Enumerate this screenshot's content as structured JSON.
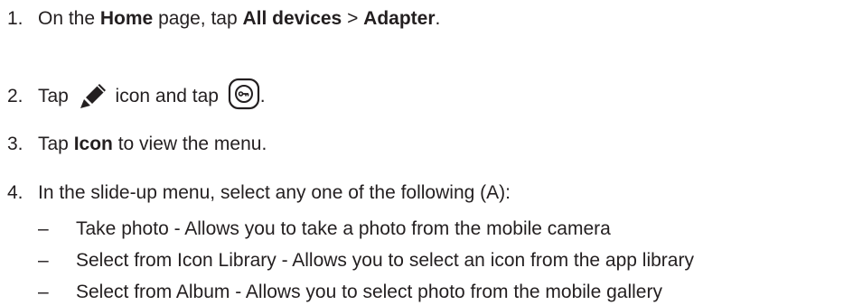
{
  "steps": [
    {
      "num": "1.",
      "parts": [
        {
          "t": "On the "
        },
        {
          "t": "Home",
          "b": true
        },
        {
          "t": " page, tap "
        },
        {
          "t": "All devices",
          "b": true
        },
        {
          "t": " > "
        },
        {
          "t": "Adapter",
          "b": true
        },
        {
          "t": "."
        }
      ]
    },
    {
      "num": "2.",
      "parts": [
        {
          "t": "Tap "
        },
        {
          "icon": "pencil-icon"
        },
        {
          "t": " icon and tap "
        },
        {
          "icon": "adapter-icon"
        },
        {
          "t": "."
        }
      ]
    },
    {
      "num": "3.",
      "parts": [
        {
          "t": "Tap "
        },
        {
          "t": "Icon",
          "b": true
        },
        {
          "t": " to view the menu."
        }
      ]
    },
    {
      "num": "4.",
      "parts": [
        {
          "t": "In the slide-up menu, select any one of the following (A):"
        }
      ]
    }
  ],
  "subitems": [
    {
      "dash": "–",
      "text": "Take photo - Allows you to take a photo from the mobile camera"
    },
    {
      "dash": "–",
      "text": "Select from Icon Library - Allows you to select an icon from the app library"
    },
    {
      "dash": "–",
      "text": "Select from Album - Allows you to select photo from the mobile gallery"
    }
  ],
  "colors": {
    "text": "#231f20",
    "background": "#ffffff"
  }
}
